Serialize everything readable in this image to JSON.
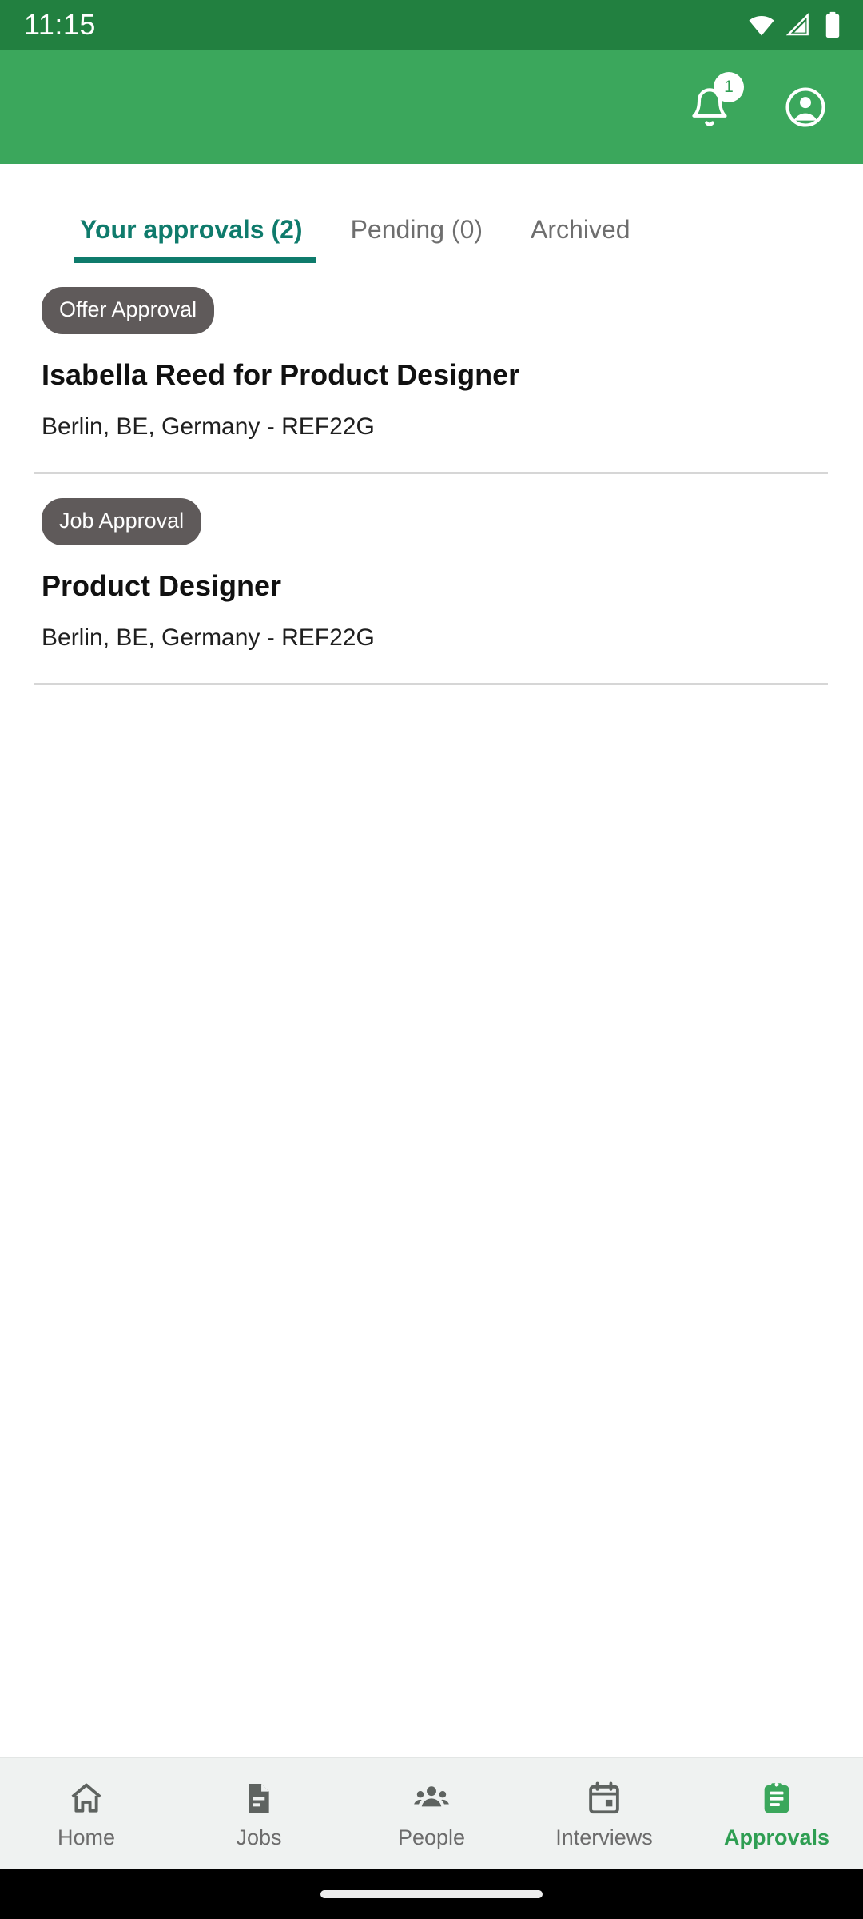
{
  "status_bar": {
    "clock": "11:15",
    "icons": [
      "wifi-icon",
      "cellular-signal-icon",
      "battery-icon"
    ]
  },
  "app_bar": {
    "background_color": "#3BA75C",
    "notifications": {
      "icon": "notifications-bell-icon",
      "badge_count": "1"
    },
    "account": {
      "icon": "account-circle-icon"
    }
  },
  "tabs": {
    "active_color": "#0F7B6C",
    "items": [
      {
        "label": "Your approvals (2)",
        "active": true
      },
      {
        "label": "Pending (0)",
        "active": false
      },
      {
        "label": "Archived",
        "active": false
      }
    ]
  },
  "approvals": [
    {
      "badge": "Offer Approval",
      "title": "Isabella Reed for Product Designer",
      "subtitle": "Berlin, BE, Germany - REF22G"
    },
    {
      "badge": "Job Approval",
      "title": "Product Designer",
      "subtitle": "Berlin, BE, Germany - REF22G"
    }
  ],
  "bottom_nav": {
    "active_color": "#2E9E52",
    "items": [
      {
        "label": "Home",
        "icon": "home-icon",
        "active": false
      },
      {
        "label": "Jobs",
        "icon": "document-icon",
        "active": false
      },
      {
        "label": "People",
        "icon": "people-group-icon",
        "active": false
      },
      {
        "label": "Interviews",
        "icon": "calendar-icon",
        "active": false
      },
      {
        "label": "Approvals",
        "icon": "clipboard-icon",
        "active": true
      }
    ]
  }
}
